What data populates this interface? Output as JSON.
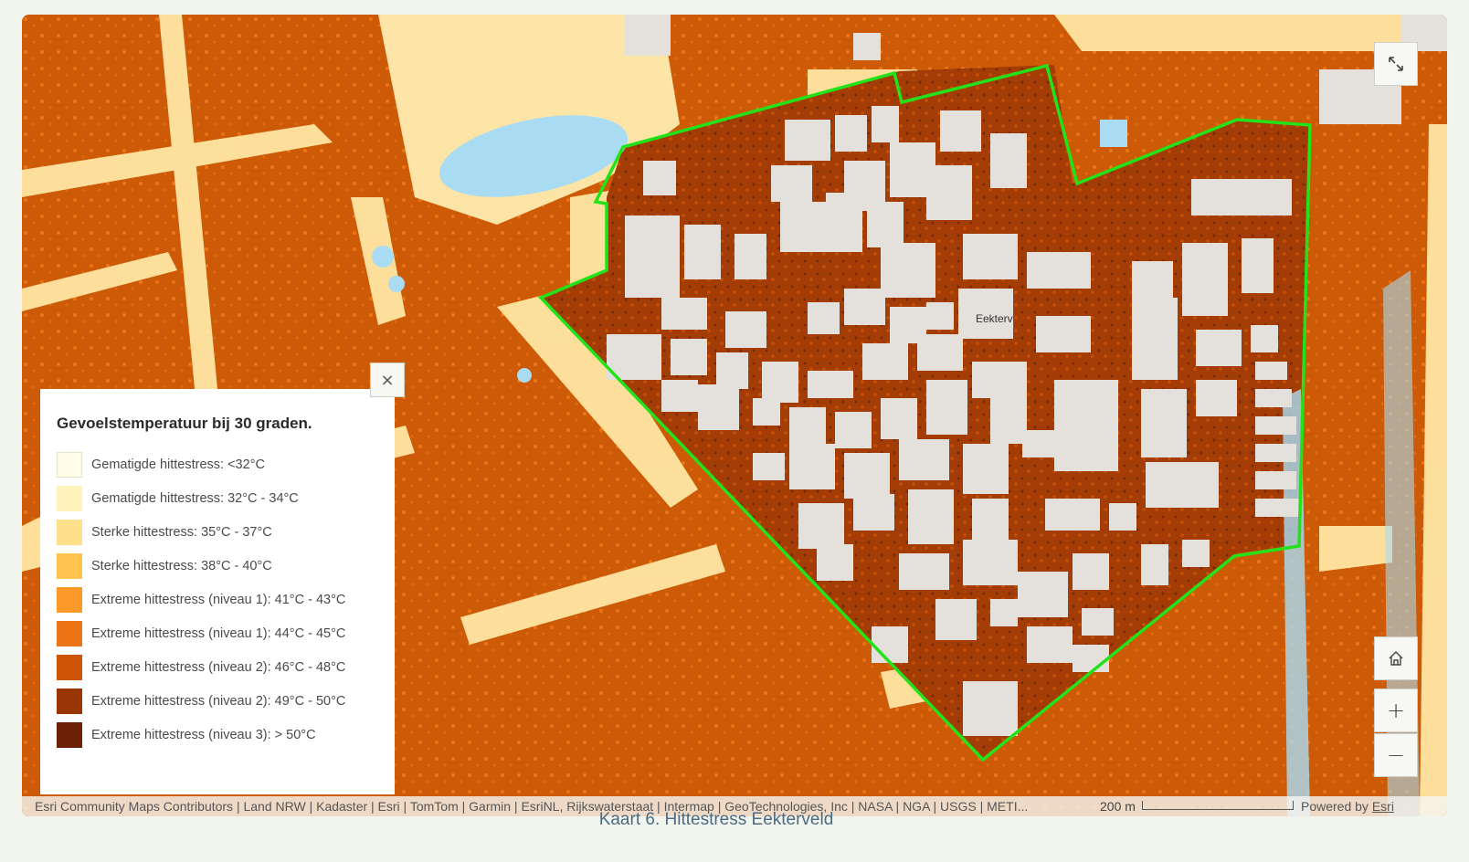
{
  "legend": {
    "title": "Gevoelstemperatuur bij 30 graden.",
    "items": [
      {
        "label": "Gematigde hittestress: <32°C",
        "color": "#fffde8"
      },
      {
        "label": "Gematigde hittestress: 32°C - 34°C",
        "color": "#fff2bb"
      },
      {
        "label": "Sterke hittestress: 35°C - 37°C",
        "color": "#ffe08a"
      },
      {
        "label": "Sterke hittestress: 38°C - 40°C",
        "color": "#ffc24d"
      },
      {
        "label": "Extreme hittestress (niveau 1): 41°C - 43°C",
        "color": "#fb9a2a"
      },
      {
        "label": "Extreme hittestress (niveau 1): 44°C - 45°C",
        "color": "#ec7414"
      },
      {
        "label": "Extreme hittestress (niveau 2): 46°C - 48°C",
        "color": "#cc5506"
      },
      {
        "label": "Extreme hittestress (niveau 2): 49°C - 50°C",
        "color": "#9a3605"
      },
      {
        "label": "Extreme hittestress (niveau 3): > 50°C",
        "color": "#6b2005"
      }
    ],
    "close_glyph": "×"
  },
  "map": {
    "place_label": "Eekterv",
    "boundary_color": "#22e31a",
    "water_color": "#a9dcf3",
    "building_color": "#e4e1dc",
    "controls": {
      "expand_icon": "expand-icon",
      "home_icon": "home-icon",
      "zoom_in": "+",
      "zoom_out": "−"
    }
  },
  "attribution": {
    "text": "Esri Community Maps Contributors | Land NRW | Kadaster | Esri | TomTom | Garmin | EsriNL, Rijkswaterstaat | Intermap | GeoTechnologies, Inc | NASA | NGA | USGS | METI...",
    "scale_label": "200 m",
    "powered_prefix": "Powered by",
    "powered_link": "Esri"
  },
  "caption": "Kaart 6. Hittestress Eekterveld"
}
